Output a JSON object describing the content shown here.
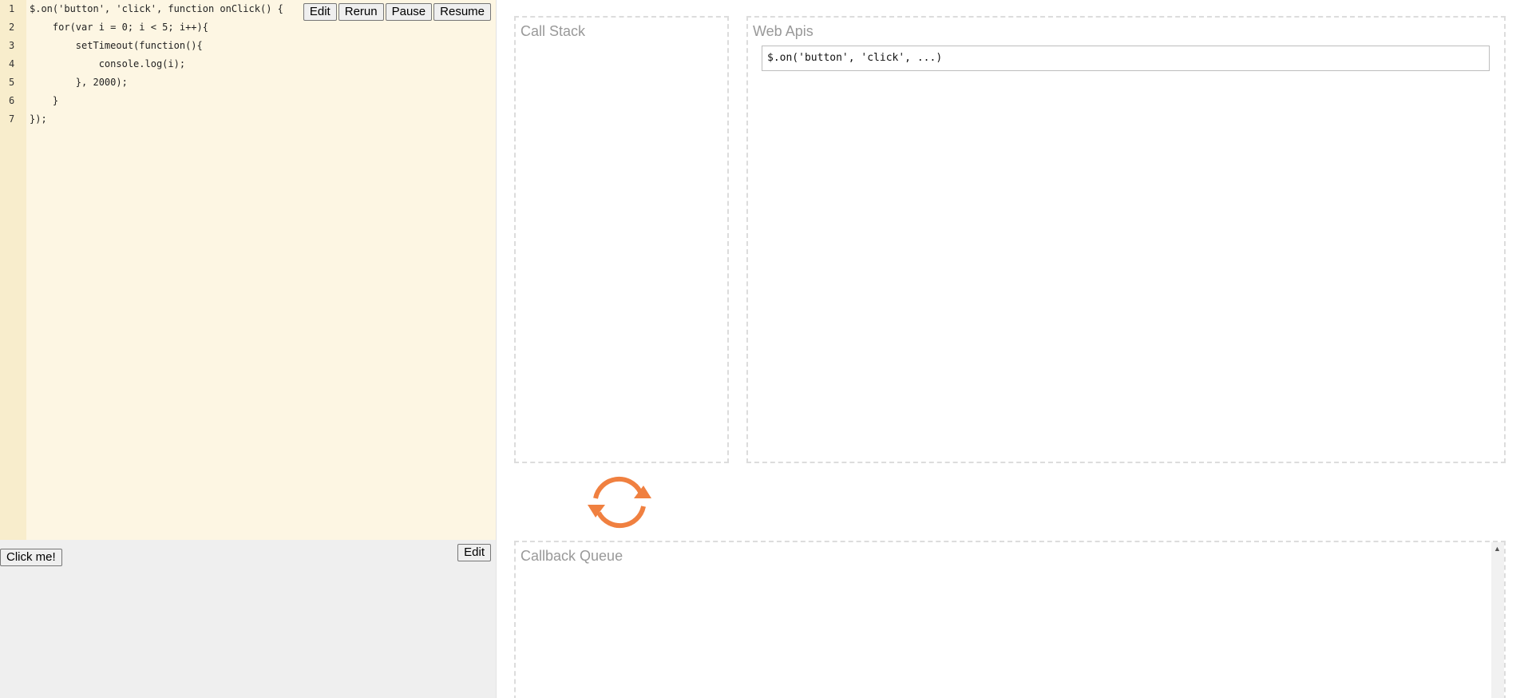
{
  "editor": {
    "lines": [
      {
        "num": "1",
        "text": "$.on('button', 'click', function onClick() {"
      },
      {
        "num": "2",
        "text": "    for(var i = 0; i < 5; i++){"
      },
      {
        "num": "3",
        "text": "        setTimeout(function(){"
      },
      {
        "num": "4",
        "text": "            console.log(i);"
      },
      {
        "num": "5",
        "text": "        }, 2000);"
      },
      {
        "num": "6",
        "text": "    }"
      },
      {
        "num": "7",
        "text": "});"
      }
    ],
    "buttons": {
      "edit": "Edit",
      "rerun": "Rerun",
      "pause": "Pause",
      "resume": "Resume"
    }
  },
  "preview": {
    "click_button": "Click me!",
    "edit_button": "Edit"
  },
  "call_stack": {
    "title": "Call Stack"
  },
  "web_apis": {
    "title": "Web Apis",
    "items": [
      "$.on('button', 'click', ...)"
    ]
  },
  "callback_queue": {
    "title": "Callback Queue"
  },
  "colors": {
    "editor_bg": "#fdf6e3",
    "gutter_bg": "#f8edcc",
    "event_loop": "#f08040"
  },
  "icons": {
    "event_loop": "refresh-icon",
    "scroll_up": "scroll-up-icon",
    "scroll_down": "scroll-down-icon"
  }
}
